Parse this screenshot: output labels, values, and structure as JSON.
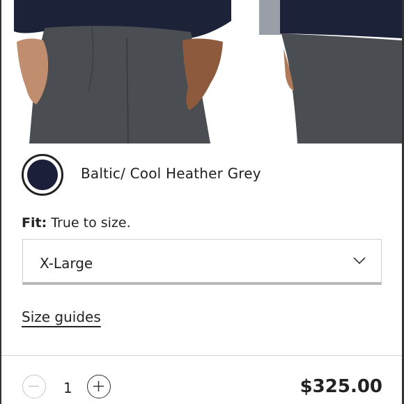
{
  "product": {
    "color_name": "Baltic/ Cool Heather Grey",
    "swatch_color": "#1b1f3a",
    "fit_label": "Fit:",
    "fit_value": "True to size.",
    "size_selected": "X-Large",
    "size_guides_label": "Size guides",
    "quantity": "1",
    "price": "$325.00"
  },
  "icons": {
    "select": "chevron-down-icon",
    "minus": "minus-icon",
    "plus": "plus-icon"
  }
}
